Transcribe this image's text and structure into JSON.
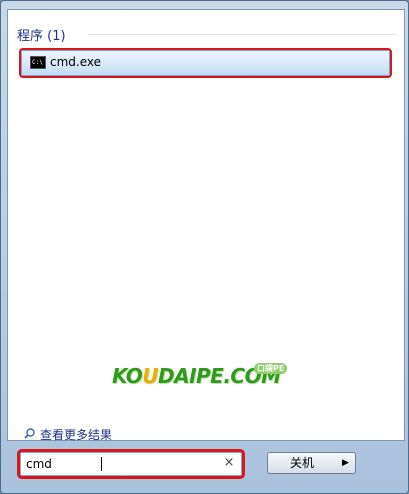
{
  "results": {
    "group_header": "程序 (1)",
    "items": [
      {
        "label": "cmd.exe",
        "icon": "cmd-icon",
        "icon_text": "C:\\"
      }
    ]
  },
  "watermark": {
    "part1": "KO",
    "part2": "U",
    "part3": "DAIPE.COM",
    "badge": "口袋PE"
  },
  "see_more": {
    "label": "查看更多结果",
    "icon": "search-icon"
  },
  "search": {
    "value": "cmd",
    "clear_label": "×"
  },
  "shutdown": {
    "label": "关机",
    "arrow_label": "▶"
  },
  "colors": {
    "highlight_border": "#d8171b",
    "link_text": "#1e3287",
    "watermark_green": "#2f9a1e",
    "watermark_orange": "#f2a900"
  }
}
